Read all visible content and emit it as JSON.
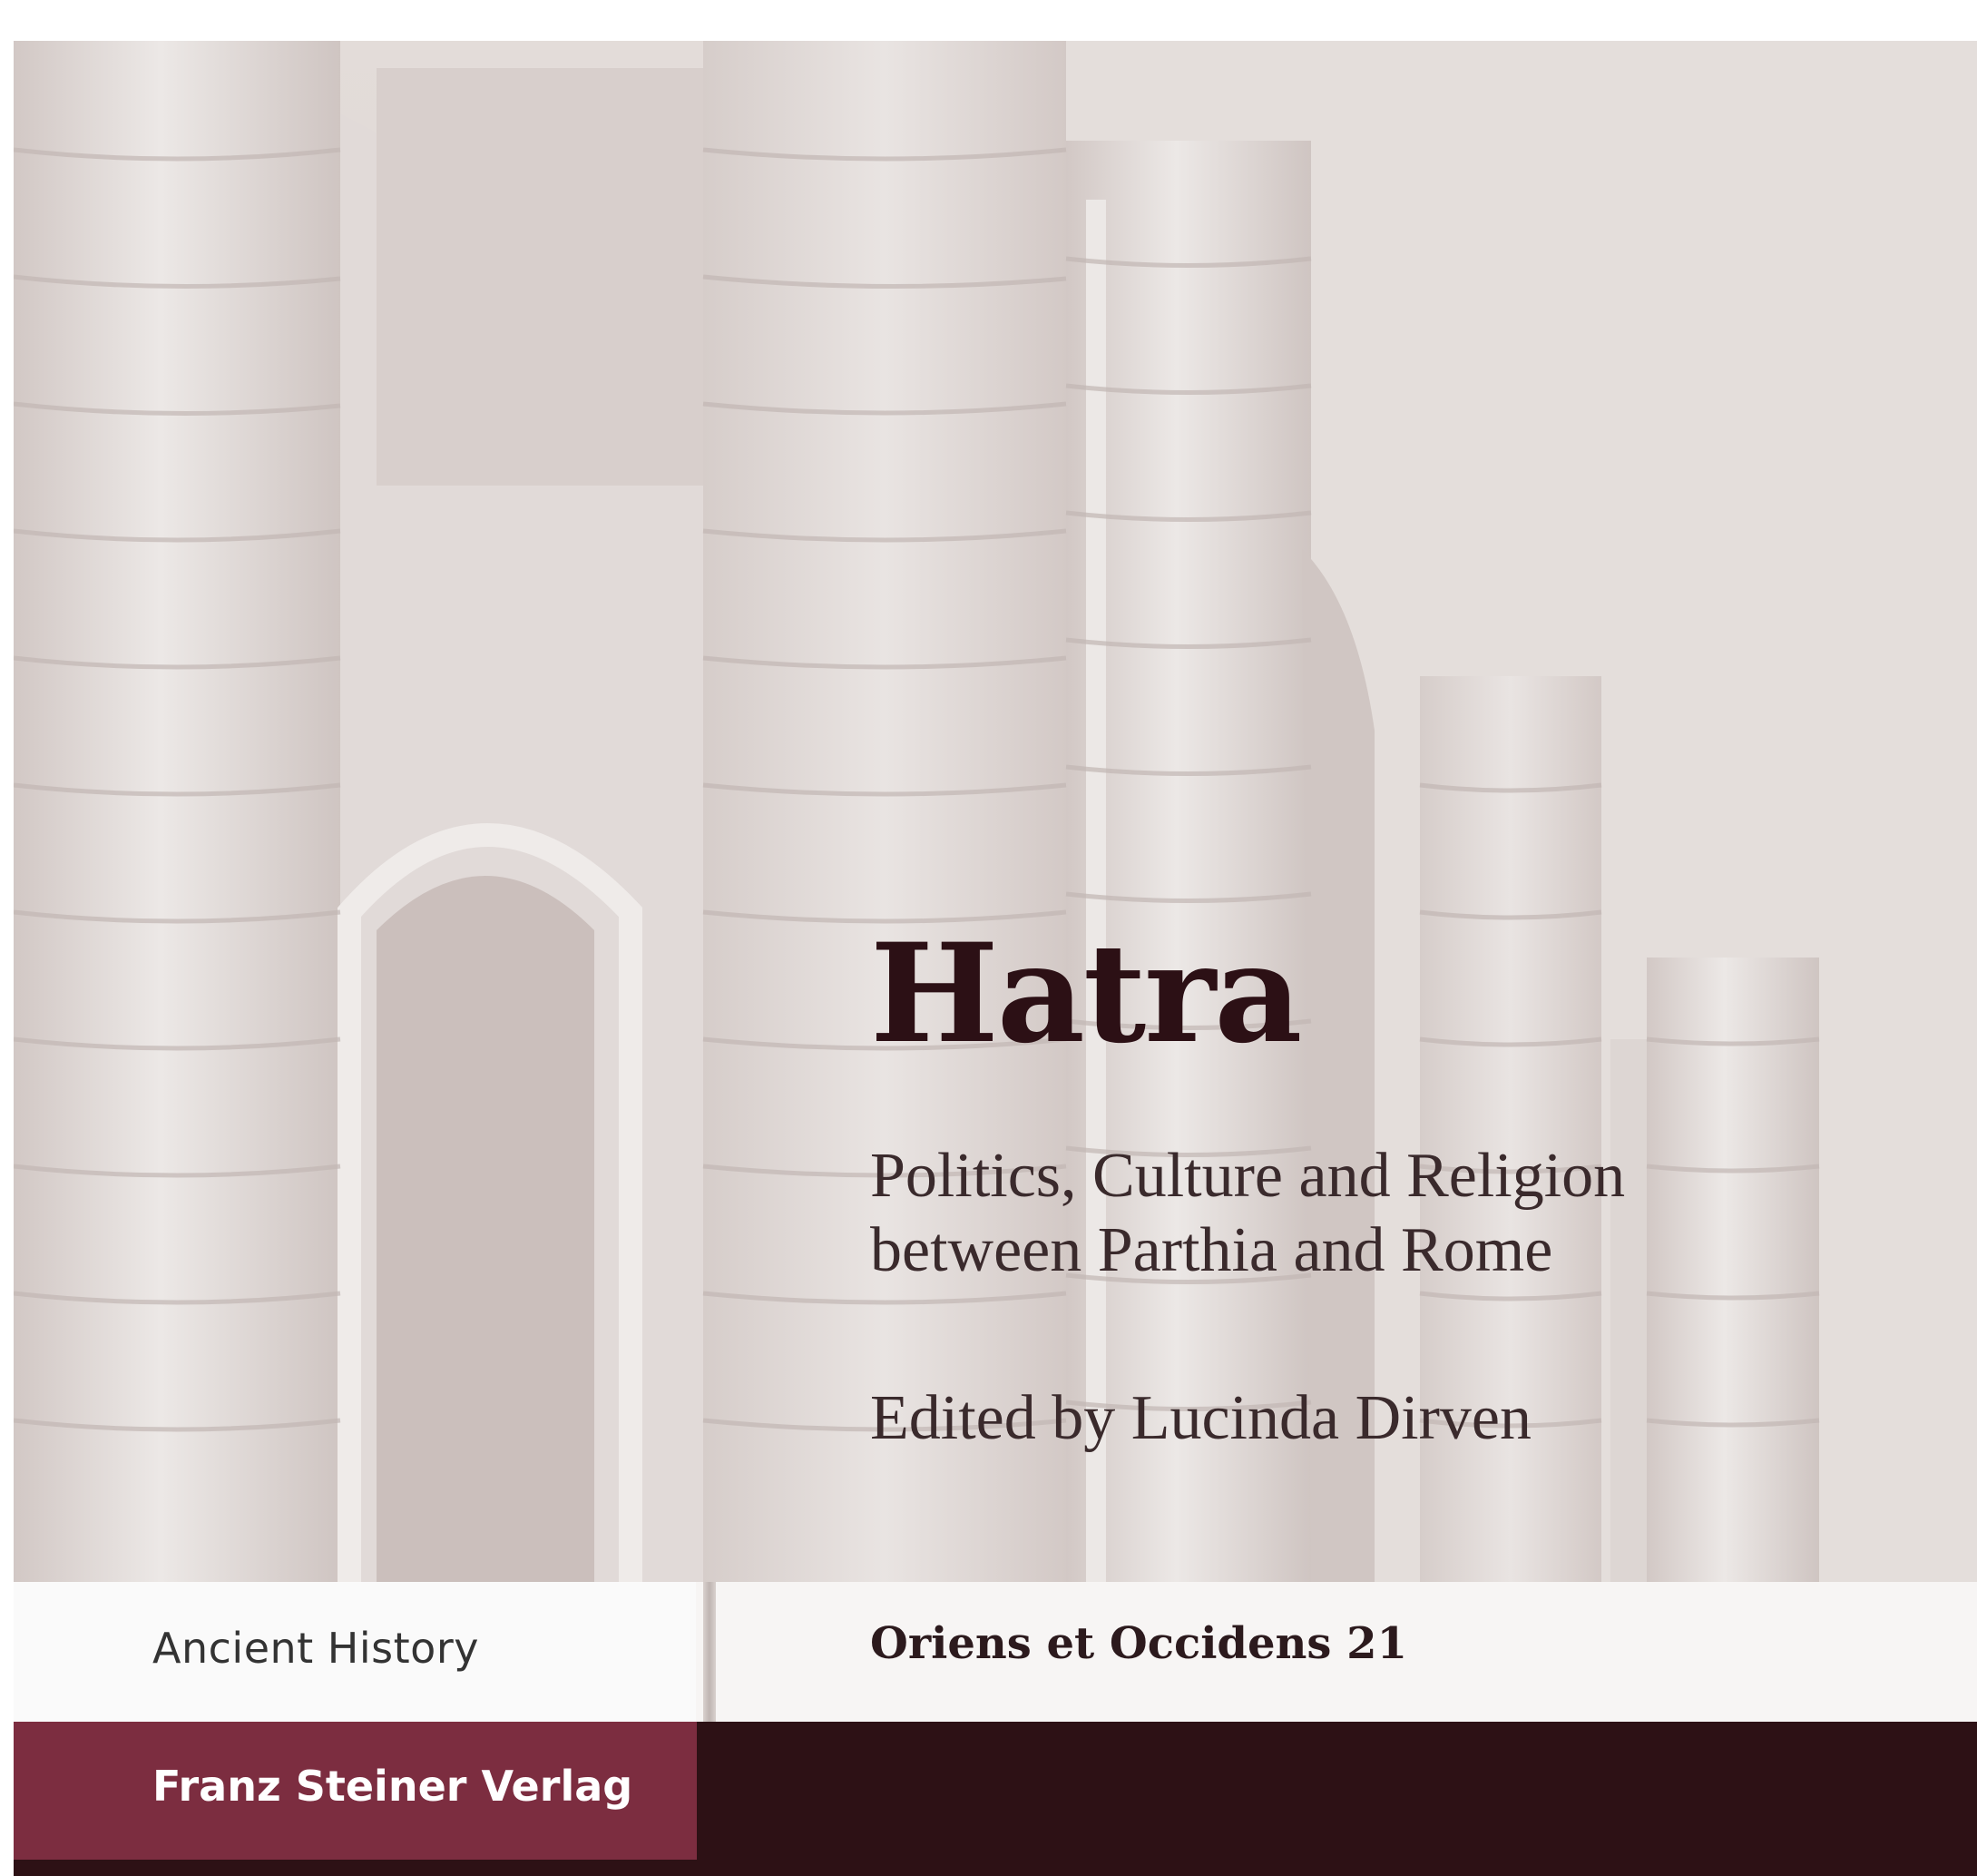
{
  "cover": {
    "title": "Hatra",
    "subtitle_line1": "Politics, Culture and Religion",
    "subtitle_line2": "between Parthia and Rome",
    "editor": "Edited by Lucinda Dirven",
    "category": "Ancient History",
    "series": "Oriens et Occidens",
    "series_number": "21",
    "publisher": "Franz Steiner Verlag"
  },
  "colors": {
    "title": "#2c1015",
    "publisher_box": "#7c2d40",
    "bottom_band": "#2d1115"
  }
}
